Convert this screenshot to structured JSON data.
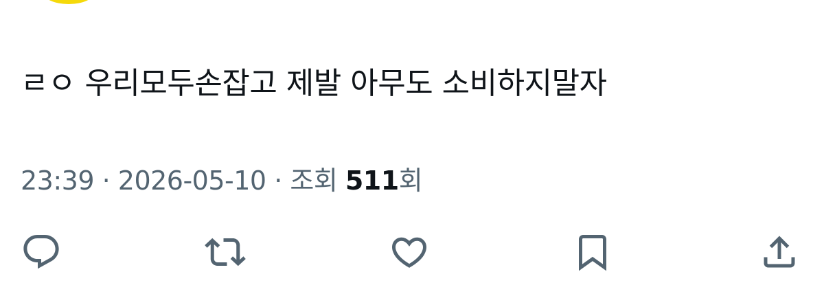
{
  "tweet": {
    "text": "ㄹㅇ 우리모두손잡고 제발 아무도 소비하지말자"
  },
  "meta": {
    "time": "23:39",
    "separator": " · ",
    "date": "2026-05-10",
    "views_prefix": "조회 ",
    "views_count": "511",
    "views_suffix": "회"
  },
  "actions": {
    "reply_icon": "reply-icon",
    "retweet_icon": "retweet-icon",
    "like_icon": "heart-icon",
    "bookmark_icon": "bookmark-icon",
    "share_icon": "share-icon"
  },
  "colors": {
    "text": "#0f1419",
    "secondary": "#536471",
    "avatar": "#f5d90a"
  }
}
